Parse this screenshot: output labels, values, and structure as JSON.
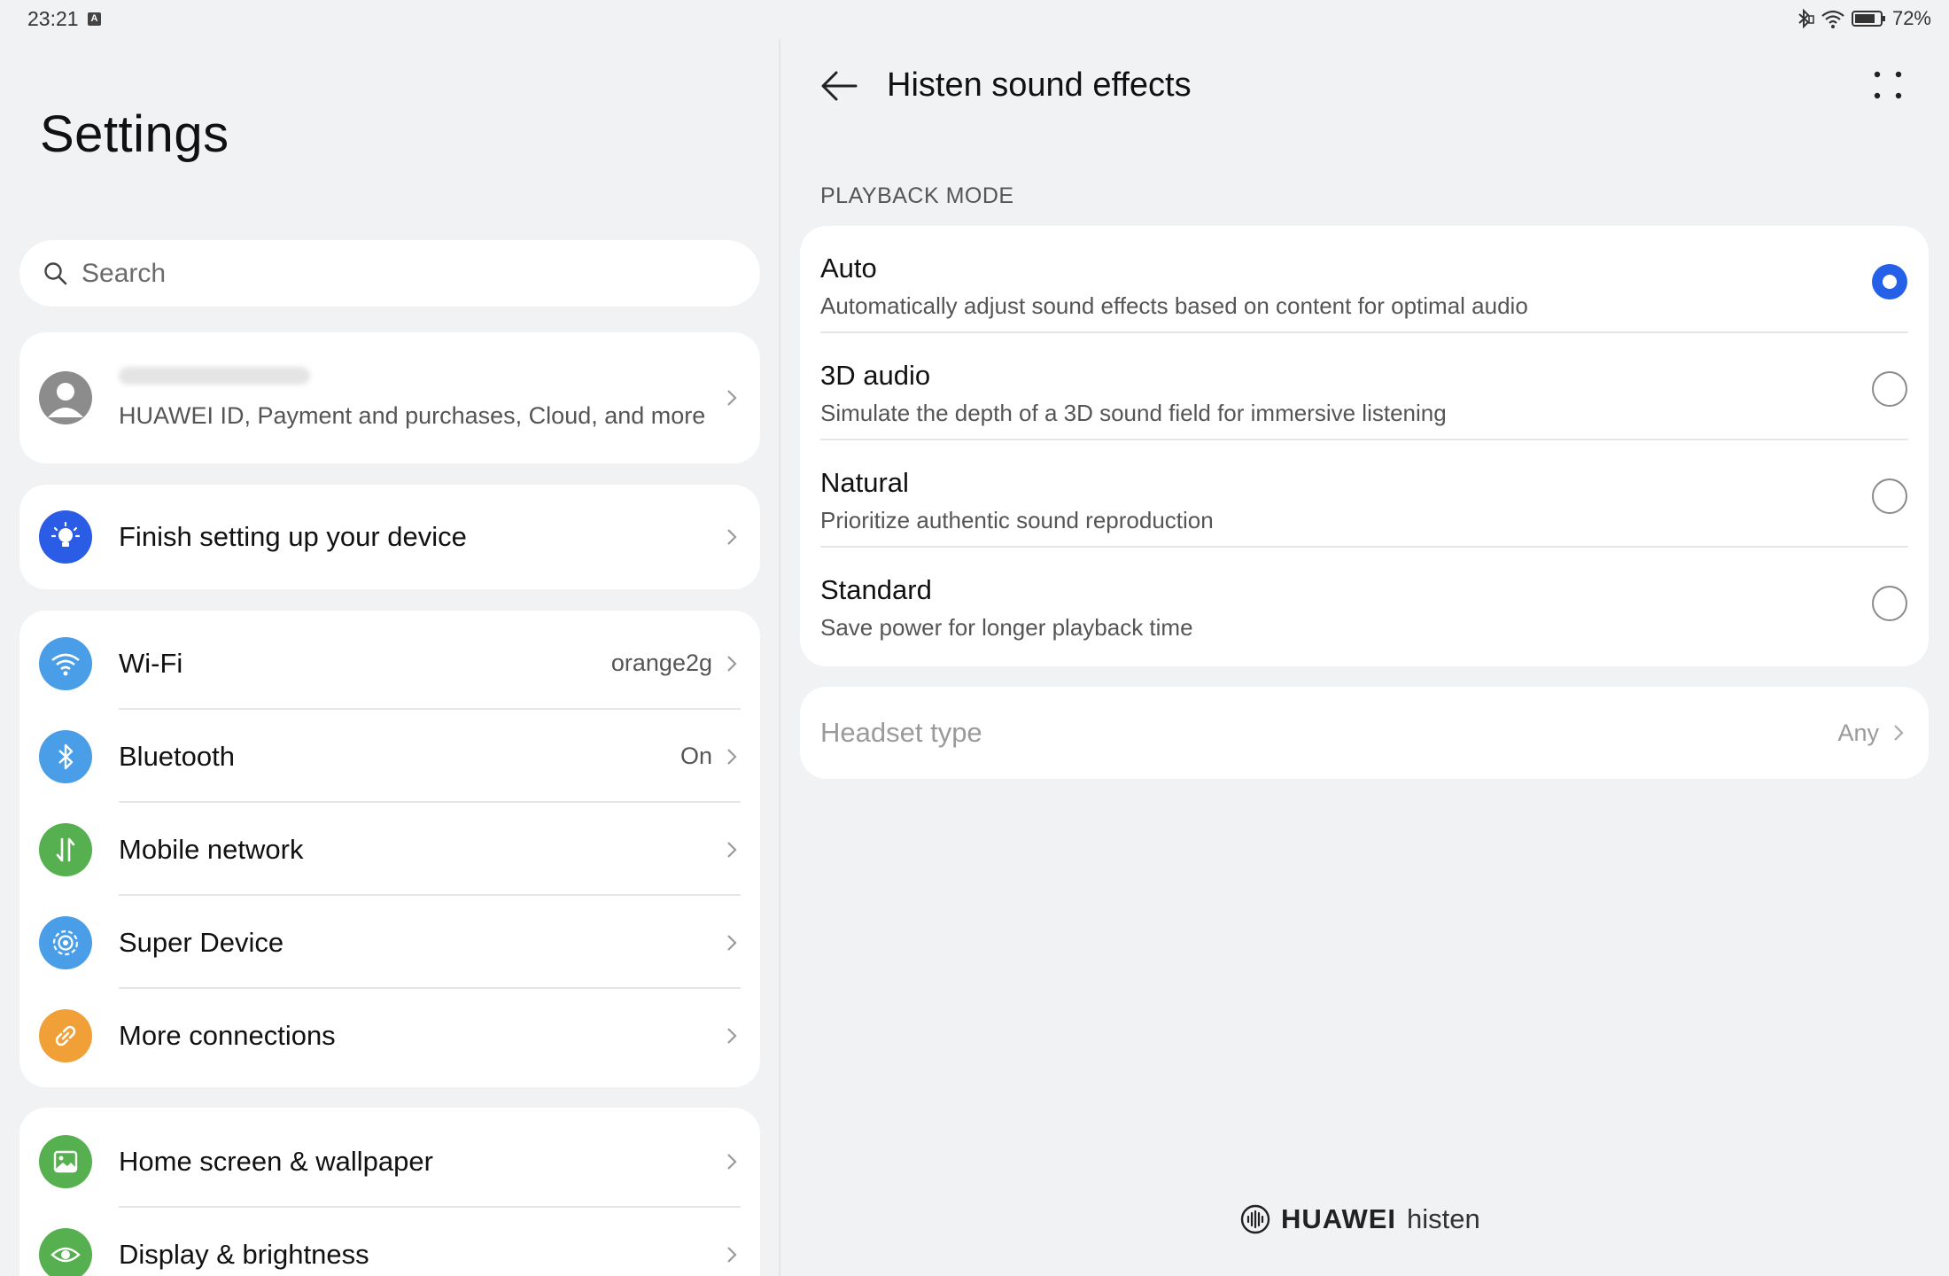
{
  "status_bar": {
    "time": "23:21",
    "notification_badge": "A",
    "battery": "72%"
  },
  "left": {
    "title": "Settings",
    "search_placeholder": "Search",
    "account": {
      "subtitle": "HUAWEI ID, Payment and purchases, Cloud, and more"
    },
    "setup": {
      "label": "Finish setting up your device",
      "icon": "lightbulb-icon",
      "color": "#2a5ce5"
    },
    "connections": [
      {
        "label": "Wi-Fi",
        "value": "orange2g",
        "icon": "wifi-icon",
        "color": "#4a9ee8"
      },
      {
        "label": "Bluetooth",
        "value": "On",
        "icon": "bluetooth-icon",
        "color": "#4a9ee8"
      },
      {
        "label": "Mobile network",
        "value": "",
        "icon": "mobile-data-icon",
        "color": "#56b04f"
      },
      {
        "label": "Super Device",
        "value": "",
        "icon": "super-device-icon",
        "color": "#4a9ee8"
      },
      {
        "label": "More connections",
        "value": "",
        "icon": "link-icon",
        "color": "#f0a037"
      }
    ],
    "display": [
      {
        "label": "Home screen & wallpaper",
        "icon": "picture-icon",
        "color": "#56b04f"
      },
      {
        "label": "Display & brightness",
        "icon": "eye-icon",
        "color": "#56b04f"
      }
    ]
  },
  "right": {
    "title": "Histen sound effects",
    "section_header": "PLAYBACK MODE",
    "modes": [
      {
        "title": "Auto",
        "desc": "Automatically adjust sound effects based on content for optimal audio",
        "selected": true
      },
      {
        "title": "3D audio",
        "desc": "Simulate the depth of a 3D sound field for immersive listening",
        "selected": false
      },
      {
        "title": "Natural",
        "desc": "Prioritize authentic sound reproduction",
        "selected": false
      },
      {
        "title": "Standard",
        "desc": "Save power for longer playback time",
        "selected": false
      }
    ],
    "headset": {
      "label": "Headset type",
      "value": "Any"
    },
    "brand": {
      "name": "HUAWEI",
      "sub": "histen"
    }
  },
  "colors": {
    "accent": "#2460e8",
    "background": "#f1f2f4",
    "card": "#ffffff"
  }
}
